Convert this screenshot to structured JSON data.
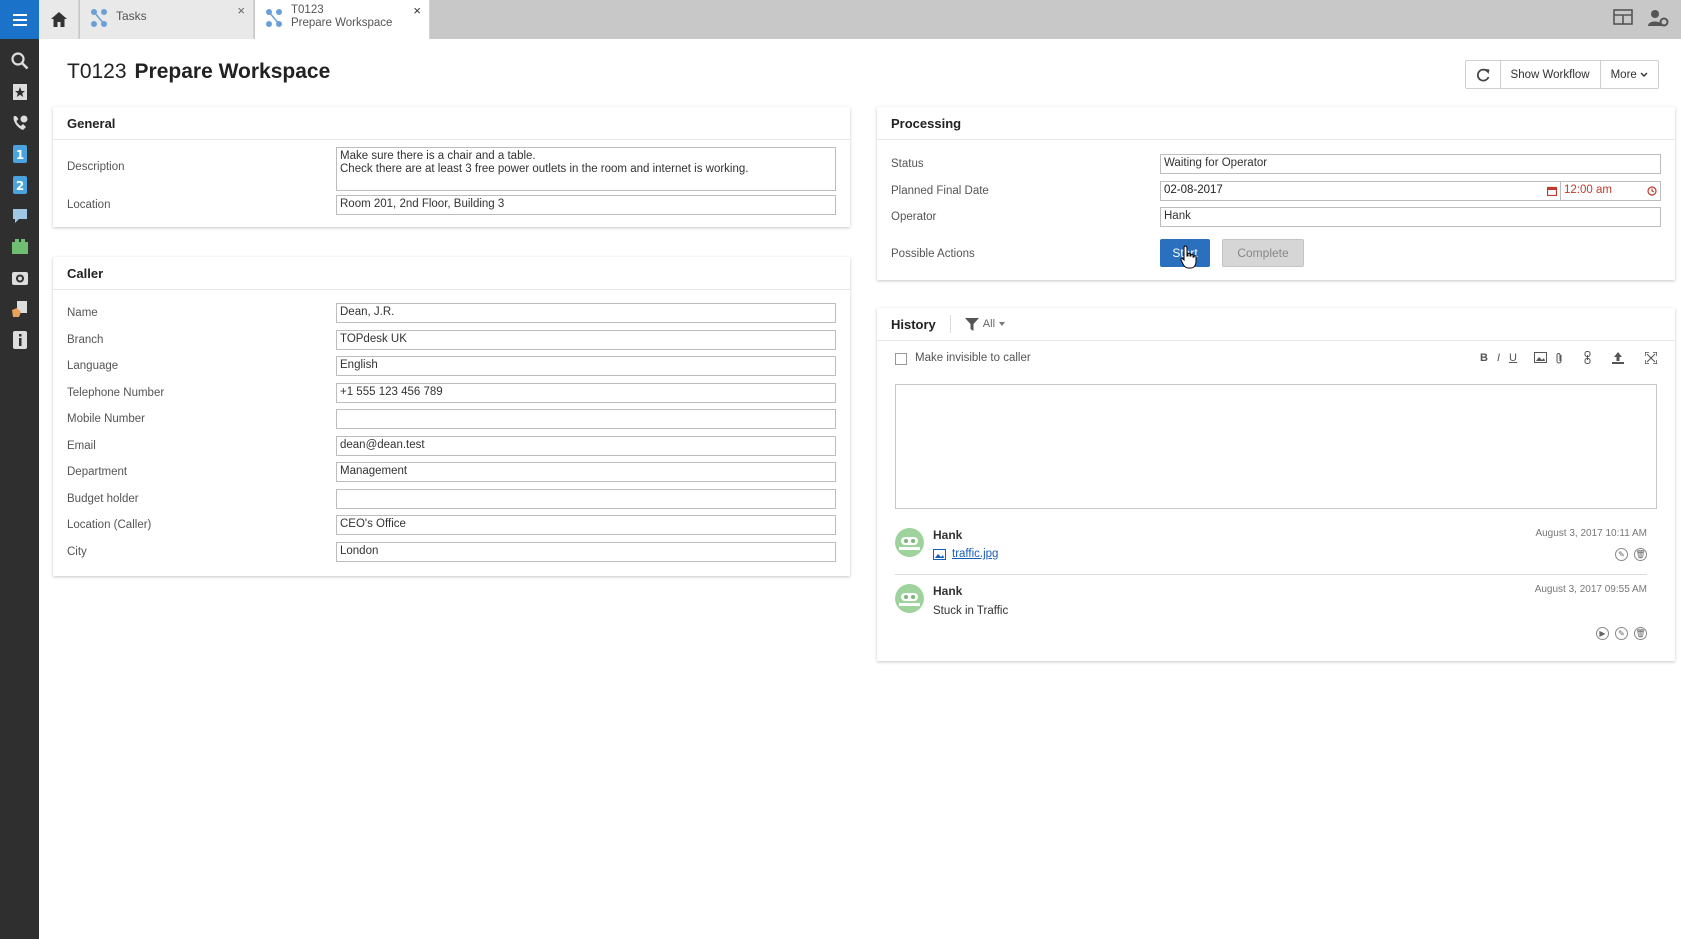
{
  "tabs": [
    {
      "title": "Tasks",
      "subtitle": ""
    },
    {
      "title": "T0123",
      "subtitle": "Prepare Workspace"
    }
  ],
  "tab_close_glyph": "×",
  "page": {
    "id": "T0123",
    "name": "Prepare Workspace"
  },
  "toolbar": {
    "show_workflow": "Show Workflow",
    "more": "More"
  },
  "general": {
    "heading": "General",
    "description_label": "Description",
    "description_value": "Make sure there is a chair and a table.\nCheck there are at least 3 free power outlets in the room and internet is working.",
    "location_label": "Location",
    "location_value": "Room 201, 2nd Floor, Building 3"
  },
  "caller": {
    "heading": "Caller",
    "fields": [
      {
        "label": "Name",
        "value": "Dean, J.R."
      },
      {
        "label": "Branch",
        "value": "TOPdesk UK"
      },
      {
        "label": "Language",
        "value": "English"
      },
      {
        "label": "Telephone Number",
        "value": "+1 555 123 456 789"
      },
      {
        "label": "Mobile Number",
        "value": ""
      },
      {
        "label": "Email",
        "value": "dean@dean.test"
      },
      {
        "label": "Department",
        "value": "Management"
      },
      {
        "label": "Budget holder",
        "value": ""
      },
      {
        "label": "Location (Caller)",
        "value": "CEO's Office"
      },
      {
        "label": "City",
        "value": "London"
      }
    ]
  },
  "processing": {
    "heading": "Processing",
    "status_label": "Status",
    "status_value": "Waiting for Operator",
    "planned_label": "Planned Final Date",
    "planned_date": "02-08-2017",
    "planned_time": "12:00 am",
    "operator_label": "Operator",
    "operator_value": "Hank",
    "actions_label": "Possible Actions",
    "start_label": "Start",
    "complete_label": "Complete"
  },
  "history": {
    "heading": "History",
    "filter_label": "All",
    "invisible_label": "Make invisible to caller",
    "format_bold": "B",
    "format_italic": "I",
    "format_underline": "U",
    "entries": [
      {
        "author": "Hank",
        "time": "August 3, 2017 10:11 AM",
        "attachment": "traffic.jpg",
        "text": ""
      },
      {
        "author": "Hank",
        "time": "August 3, 2017 09:55 AM",
        "attachment": "",
        "text": "Stuck in Traffic"
      }
    ]
  },
  "colors": {
    "accent": "#2b6fbf",
    "rail": "#2f2f2f",
    "menu": "#1a73c9",
    "date_red": "#c0392b"
  }
}
